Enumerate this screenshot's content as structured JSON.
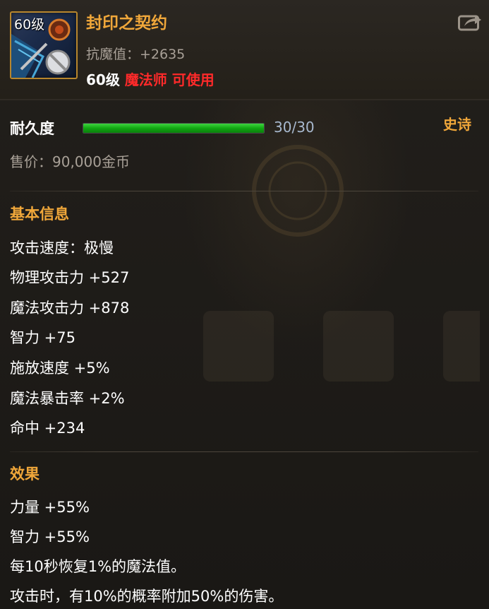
{
  "item": {
    "level_badge": "60级",
    "name": "封印之契约",
    "resist": "抗魔值：+2635",
    "requirement_level": "60级",
    "requirement_class": "魔法师 可使用",
    "icon": "staff-weapon-icon"
  },
  "durability": {
    "label": "耐久度",
    "value_text": "30/30",
    "fraction": 1.0
  },
  "rarity": "史诗",
  "price": "售价：90,000金币",
  "basic_info": {
    "title": "基本信息",
    "stats": [
      "攻击速度：极慢",
      "物理攻击力 +527",
      "魔法攻击力 +878",
      "智力 +75",
      "施放速度 +5%",
      "魔法暴击率 +2%",
      "命中 +234"
    ]
  },
  "effects": {
    "title": "效果",
    "lines": [
      "力量 +55%",
      "智力 +55%",
      "每10秒恢复1%的魔法值。",
      "攻击时，有10%的概率附加50%的伤害。"
    ]
  },
  "colors": {
    "name": "#f0a73a",
    "class_red": "#ff2a2a",
    "durability_green": "#11a812"
  },
  "share_icon": "share-icon"
}
